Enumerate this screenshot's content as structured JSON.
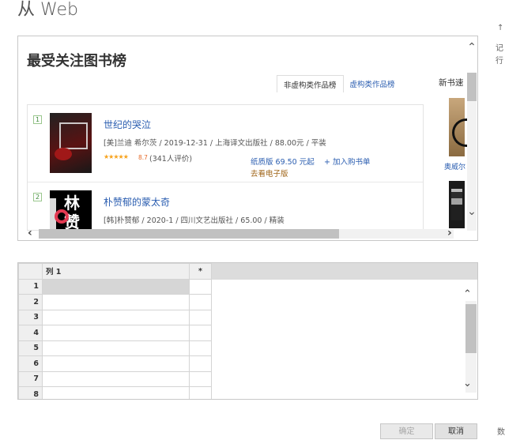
{
  "dialog": {
    "title": "从 Web",
    "edge_glyphs": [
      "↑",
      "记",
      "行"
    ],
    "corner_text": "数"
  },
  "preview": {
    "heading": "最受关注图书榜",
    "tabs": [
      {
        "label": "非虚构类作品榜",
        "active": true
      },
      {
        "label": "虚构类作品榜",
        "active": false
      }
    ],
    "side_heading": "新书速",
    "side_book_title": "奥威尔",
    "books": [
      {
        "rank": "1",
        "title": "世纪的哭泣",
        "meta": "[美]兰迪 希尔茨 / 2019-12-31 / 上海译文出版社 / 88.00元 / 平装",
        "stars": "★★★★★",
        "score": "8.7",
        "reviews": "(341人评价)",
        "paper_price": "纸质版 69.50 元起",
        "add_cart": "+ 加入购书单",
        "ebook": "去看电子版",
        "cover_text": ""
      },
      {
        "rank": "2",
        "title": "朴赞郁的蒙太奇",
        "meta": "[韩]朴赞郁 / 2020-1 / 四川文艺出版社 / 65.00 / 精装",
        "cover_text": "林赞"
      }
    ]
  },
  "grid": {
    "columns": [
      "列 1",
      "*"
    ],
    "rows": [
      "1",
      "2",
      "3",
      "4",
      "5",
      "6",
      "7",
      "8"
    ]
  },
  "buttons": {
    "ok": "确定",
    "cancel": "取消"
  },
  "colors": {
    "link": "#2a5db0",
    "star": "#f7a21b",
    "rank_border": "#9ac78e"
  },
  "icons": {
    "scroll_up": "chevron-up-icon",
    "scroll_down": "chevron-down-icon",
    "scroll_left": "chevron-left-icon",
    "scroll_right": "chevron-right-icon"
  }
}
